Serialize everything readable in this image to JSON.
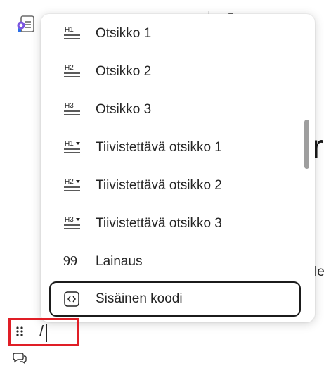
{
  "menu": {
    "items": [
      {
        "label": "Otsikko 1",
        "icon": "heading-1-icon"
      },
      {
        "label": "Otsikko 2",
        "icon": "heading-2-icon"
      },
      {
        "label": "Otsikko 3",
        "icon": "heading-3-icon"
      },
      {
        "label": "Tiivistettävä otsikko 1",
        "icon": "collapsible-heading-1-icon"
      },
      {
        "label": "Tiivistettävä otsikko 2",
        "icon": "collapsible-heading-2-icon"
      },
      {
        "label": "Tiivistettävä otsikko 3",
        "icon": "collapsible-heading-3-icon"
      },
      {
        "label": "Lainaus",
        "icon": "quote-icon"
      },
      {
        "label": "Sisäinen koodi",
        "icon": "inline-code-icon"
      }
    ],
    "selected": "Sisäinen koodi"
  },
  "icon_text": {
    "h1": "H1",
    "h2": "H2",
    "h3": "H3",
    "quote": "99"
  },
  "editor": {
    "input_text": "/"
  },
  "background": {
    "partial_letter": "r",
    "partial_text": "le"
  },
  "colors": {
    "focus_outline": "#e01e26",
    "logo_accent": "#7b55e0",
    "logo_blue": "#2b6fe8"
  }
}
